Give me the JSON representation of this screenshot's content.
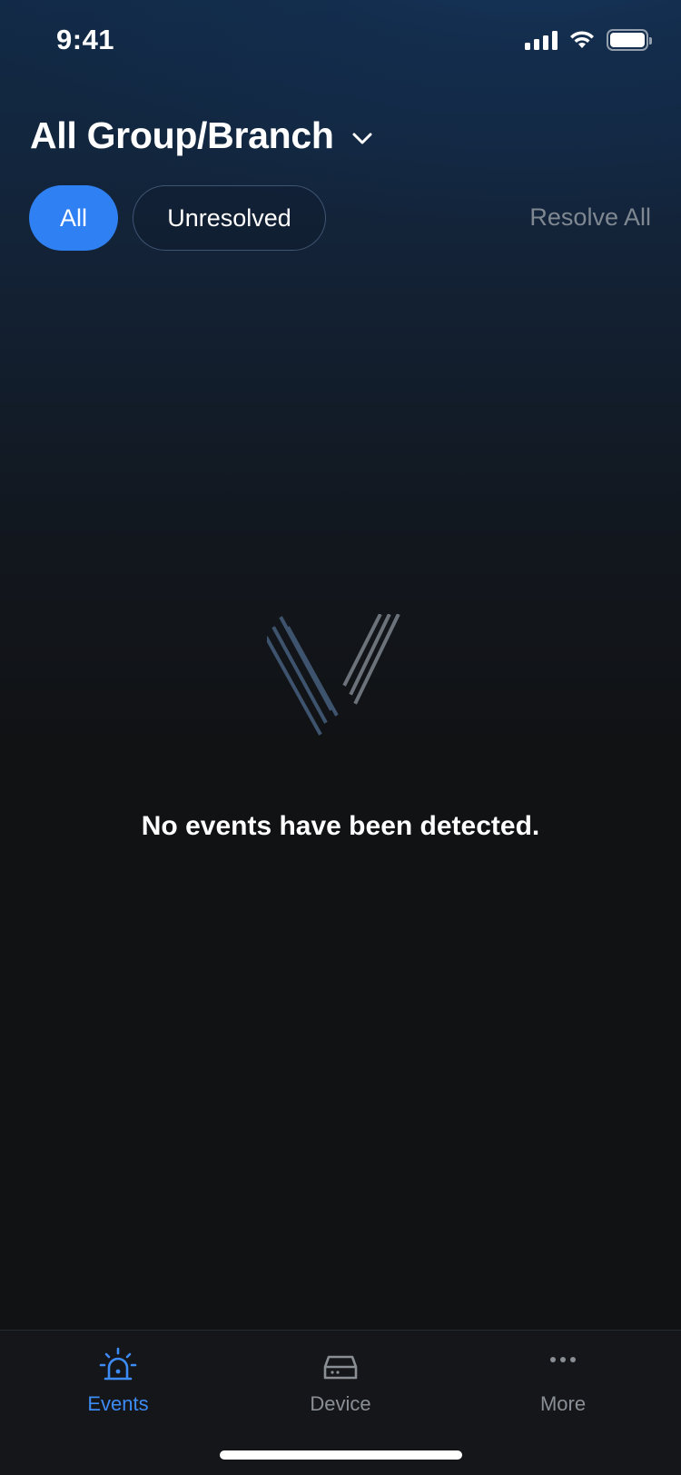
{
  "status_bar": {
    "time": "9:41"
  },
  "header": {
    "title": "All Group/Branch"
  },
  "filters": {
    "all_label": "All",
    "unresolved_label": "Unresolved",
    "resolve_all_label": "Resolve All"
  },
  "empty_state": {
    "message": "No events have been detected."
  },
  "tabbar": {
    "items": [
      {
        "label": "Events",
        "icon": "siren-icon",
        "active": true
      },
      {
        "label": "Device",
        "icon": "device-icon",
        "active": false
      },
      {
        "label": "More",
        "icon": "more-icon",
        "active": false
      }
    ],
    "active_color": "#3d8bf5",
    "inactive_color": "#8a8f96"
  },
  "colors": {
    "accent": "#2f80f2",
    "background": "#111214"
  }
}
